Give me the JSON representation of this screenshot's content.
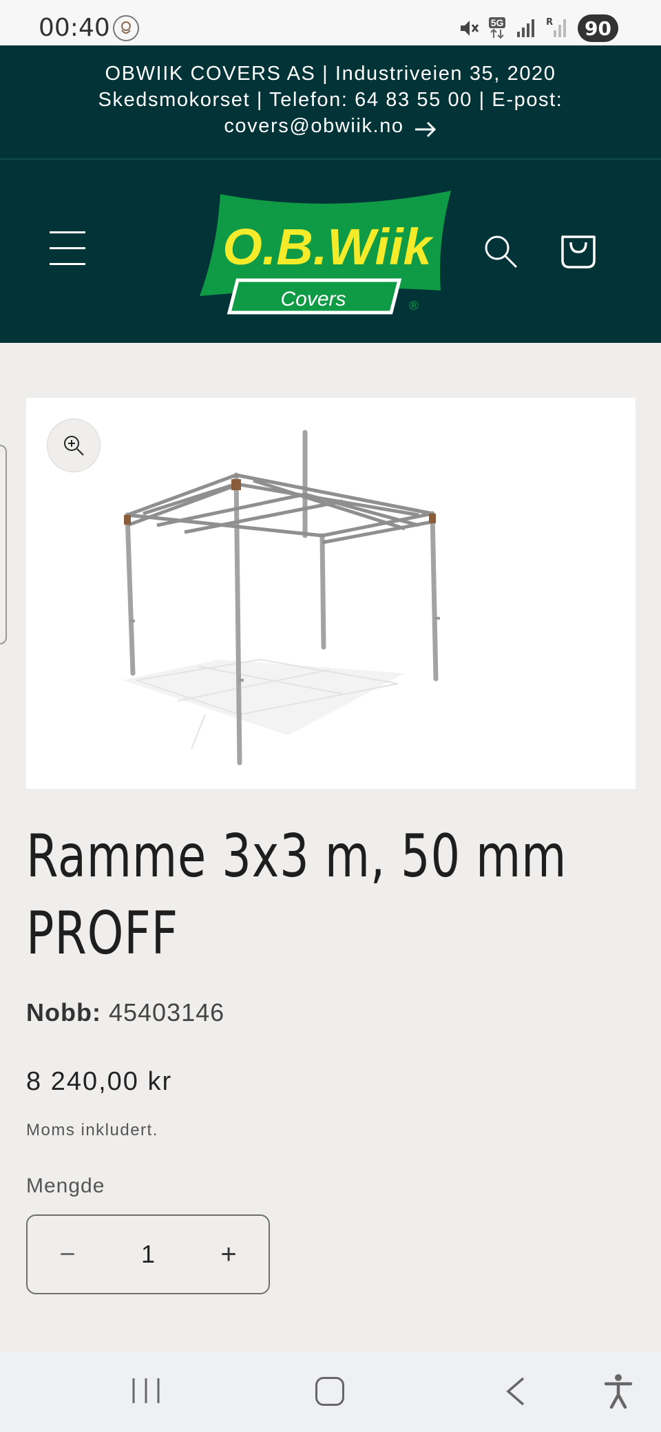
{
  "status_bar": {
    "time": "00:40",
    "battery": "90",
    "network": "5G",
    "icons": [
      "flower-icon",
      "mute-icon",
      "5g-icon",
      "signal-icon",
      "signal-roaming-icon",
      "battery-icon"
    ]
  },
  "announcement": {
    "text": "OBWIIK COVERS AS | Industriveien 35, 2020 Skedsmokorset | Telefon: 64 83 55 00 | E-post: covers@obwiik.no",
    "icon": "arrow-right-icon"
  },
  "header": {
    "logo_main": "O.B.Wiik",
    "logo_sub": "Covers",
    "logo_mark": "®",
    "brand_colors": {
      "header_bg": "#023437",
      "logo_green": "#0f9a46",
      "logo_yellow": "#f4ec2b"
    }
  },
  "product": {
    "title": "Ramme 3x3 m, 50 mm PROFF",
    "nobb_label": "Nobb:",
    "nobb_value": "45403146",
    "price": "8 240,00 kr",
    "tax_note": "Moms inkludert.",
    "quantity_label": "Mengde",
    "quantity_value": "1",
    "minus_label": "−",
    "plus_label": "+"
  },
  "nav": {
    "icons": [
      "recent-apps-icon",
      "home-icon",
      "back-icon",
      "accessibility-icon"
    ]
  }
}
